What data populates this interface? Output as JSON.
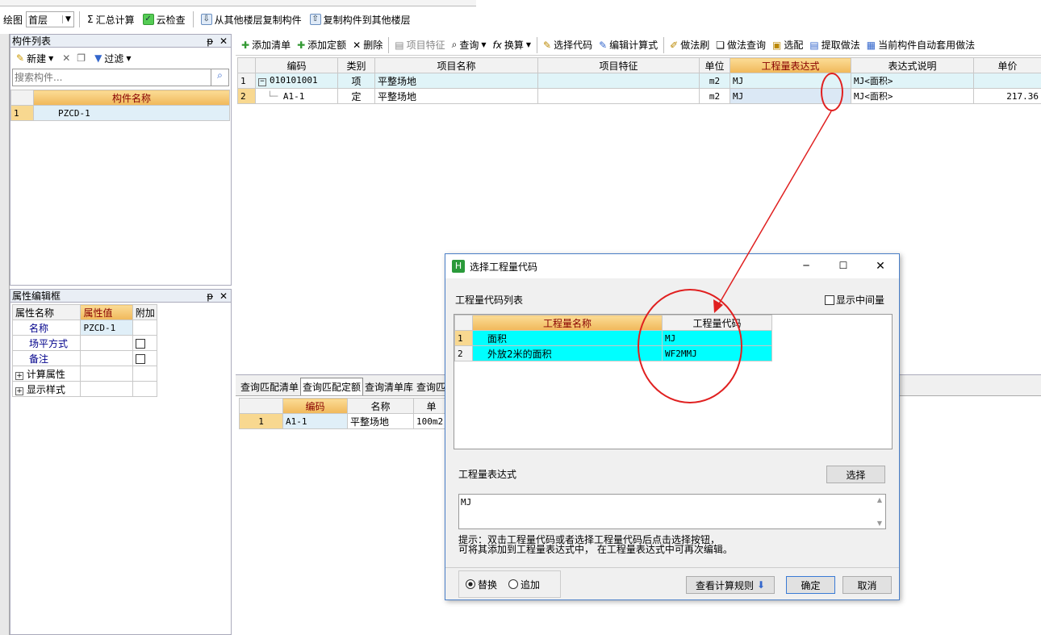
{
  "toolbar1": {
    "draw_label": "绘图",
    "floor_value": "首层",
    "sum_label": "汇总计算",
    "cloud_check_label": "云检查",
    "copy_from_floor_label": "从其他楼层复制构件",
    "copy_to_floor_label": "复制构件到其他楼层"
  },
  "component_list": {
    "title": "构件列表",
    "new_label": "新建",
    "filter_label": "过滤",
    "search_placeholder": "搜索构件...",
    "header": "构件名称",
    "rows": [
      {
        "num": "1",
        "name": "PZCD-1"
      }
    ]
  },
  "props": {
    "title": "属性编辑框",
    "headers": [
      "属性名称",
      "属性值",
      "附加"
    ],
    "rows": [
      {
        "name": "名称",
        "value": "PZCD-1"
      },
      {
        "name": "场平方式",
        "value": ""
      },
      {
        "name": "备注",
        "value": ""
      }
    ],
    "groups": [
      "计算属性",
      "显示样式"
    ]
  },
  "toolbar2": {
    "items": [
      "添加清单",
      "添加定额",
      "删除",
      "项目特征",
      "查询",
      "换算",
      "选择代码",
      "编辑计算式",
      "做法刷",
      "做法查询",
      "选配",
      "提取做法",
      "当前构件自动套用做法"
    ]
  },
  "main_grid": {
    "headers": [
      "编码",
      "类别",
      "项目名称",
      "项目特征",
      "单位",
      "工程量表达式",
      "表达式说明",
      "单价"
    ],
    "rows": [
      {
        "num": "1",
        "code": "010101001",
        "type": "项",
        "name": "平整场地",
        "feature": "",
        "unit": "m2",
        "expr": "MJ",
        "desc": "MJ<面积>",
        "price": ""
      },
      {
        "num": "2",
        "code": "A1-1",
        "type": "定",
        "name": "平整场地",
        "feature": "",
        "unit": "m2",
        "expr": "MJ",
        "desc": "MJ<面积>",
        "price": "217.36"
      }
    ]
  },
  "bottom": {
    "tabs": [
      "查询匹配清单",
      "查询匹配定额",
      "查询清单库",
      "查询匹"
    ],
    "headers": [
      "编码",
      "名称",
      "单"
    ],
    "rows": [
      {
        "num": "1",
        "code": "A1-1",
        "name": "平整场地",
        "unit": "100m2"
      }
    ]
  },
  "dialog": {
    "title": "选择工程量代码",
    "list_label": "工程量代码列表",
    "show_intermediate_label": "显示中间量",
    "headers": [
      "工程量名称",
      "工程量代码"
    ],
    "rows": [
      {
        "num": "1",
        "name": "面积",
        "code": "MJ"
      },
      {
        "num": "2",
        "name": "外放2米的面积",
        "code": "WF2MMJ"
      }
    ],
    "expr_label": "工程量表达式",
    "select_button": "选择",
    "expr_value": "MJ",
    "hint_line1": "提示：双击工程量代码或者选择工程量代码后点击选择按钮，",
    "hint_line2": "可将其添加到工程量表达式中， 在工程量表达式中可再次编辑。",
    "radio_replace": "替换",
    "radio_append": "追加",
    "view_rules_button": "查看计算规则",
    "ok_button": "确定",
    "cancel_button": "取消"
  },
  "colors": {
    "accent_header": "#f0b85a",
    "cyan_row": "#00ffff",
    "annotation_red": "#e02020"
  }
}
